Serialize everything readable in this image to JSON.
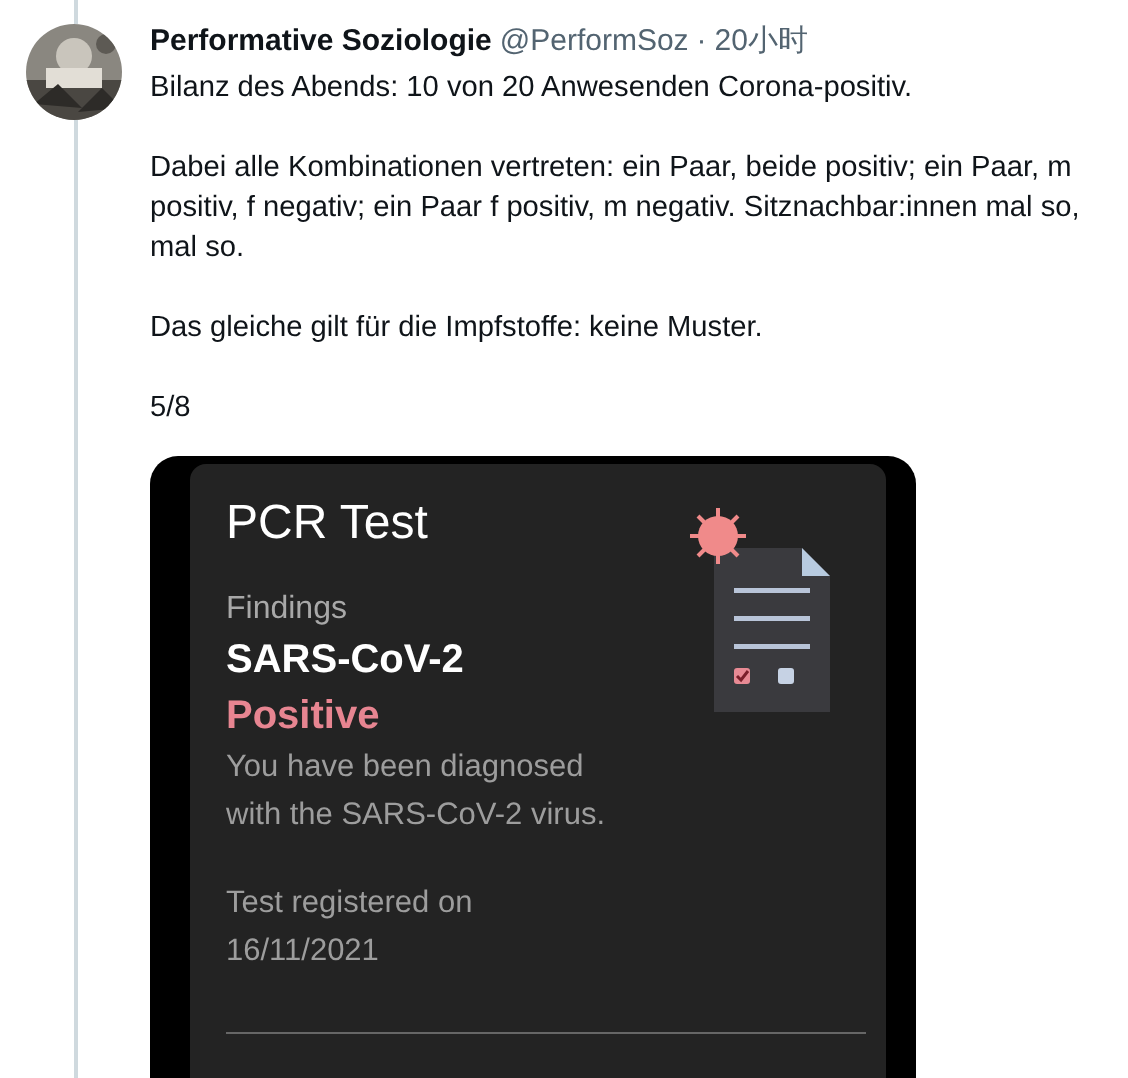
{
  "tweet": {
    "author": {
      "name": "Performative Soziologie",
      "handle": "@PerformSoz",
      "separator": "·",
      "time": "20小时"
    },
    "paragraphs": [
      "Bilanz des Abends: 10 von 20 Anwesenden Corona-positiv.",
      "Dabei alle Kombinationen vertreten: ein Paar, beide positiv; ein Paar, m positiv, f negativ; ein Paar f positiv, m negativ. Sitznachbar:innen mal so, mal so.",
      "Das gleiche gilt für die Impfstoffe: keine Muster.",
      "5/8"
    ],
    "media": {
      "title": "PCR Test",
      "findings_label": "Findings",
      "pathogen": "SARS-CoV-2",
      "result": "Positive",
      "description": "You have been diagnosed with the SARS-CoV-2 virus.",
      "registered_label": "Test registered on",
      "registered_date": "16/11/2021"
    }
  }
}
